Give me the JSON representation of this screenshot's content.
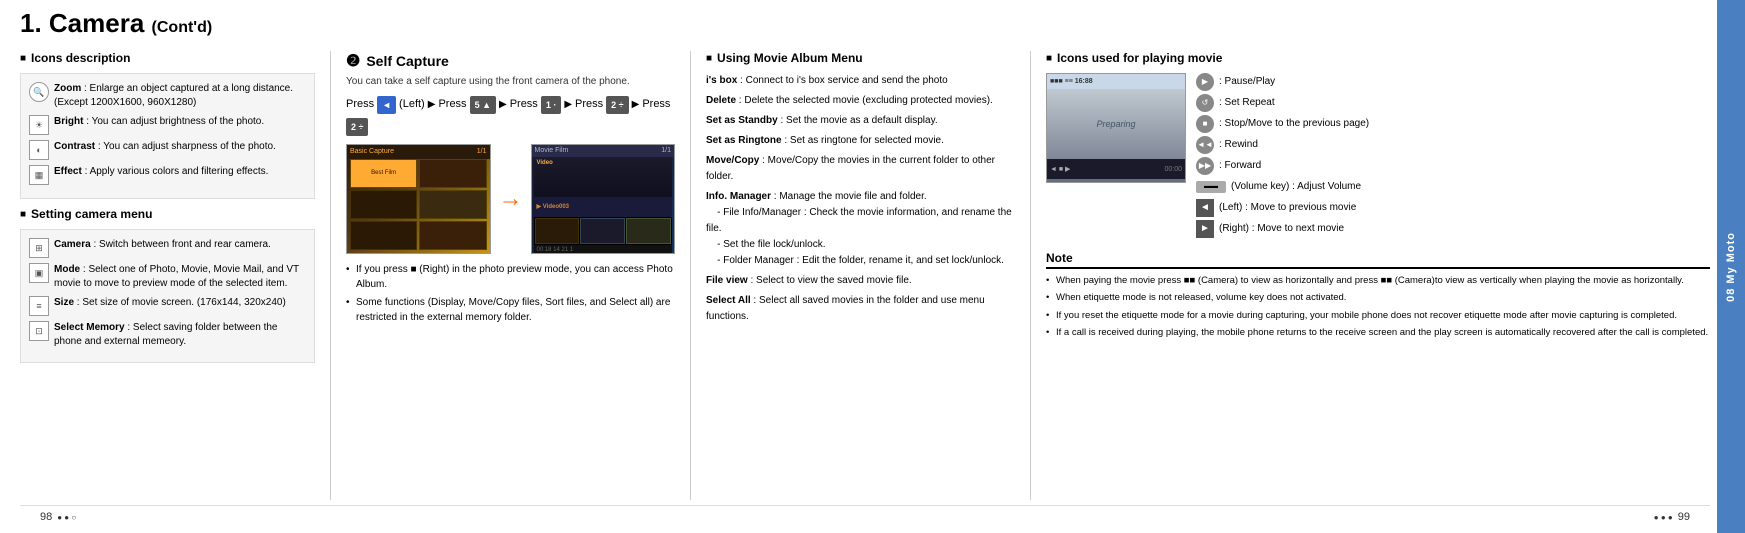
{
  "page": {
    "title": "1. Camera",
    "title_cont": "(Cont'd)",
    "chapter": "08 My Moto",
    "page_left": "98",
    "page_right": "99",
    "dots_left": "● ● ○",
    "dots_right": "● ● ● 99"
  },
  "col1": {
    "icons_title": "Icons description",
    "icons": [
      {
        "name": "Zoom",
        "desc": "Enlarge an object captured at a long distance. (Except 1200X1600, 960X1280)"
      },
      {
        "name": "Bright",
        "desc": "You can adjust brightness of the photo."
      },
      {
        "name": "Contrast",
        "desc": "You can adjust sharpness of the photo."
      },
      {
        "name": "Effect",
        "desc": "Apply various colors and filtering effects."
      }
    ],
    "settings_title": "Setting camera menu",
    "settings": [
      {
        "name": "Camera",
        "desc": "Switch between front and rear camera."
      },
      {
        "name": "Mode",
        "desc": "Select one of Photo, Movie, Movie Mail, and VT movie to move to preview mode of the selected item."
      },
      {
        "name": "Size",
        "desc": "Set size of movie screen. (176x144, 320x240)"
      },
      {
        "name": "Select Memory",
        "desc": "Select saving folder between the phone and external memeory."
      }
    ]
  },
  "col2": {
    "number": "❷",
    "title": "Self Capture",
    "subtitle": "You can take a self capture using the front camera of the phone.",
    "press_steps": [
      {
        "label": "Press",
        "btn": "◄ (Left)"
      },
      {
        "label": "Press",
        "btn": "5 ▲"
      },
      {
        "label": "Press",
        "btn": "1 ·"
      },
      {
        "label": "Press",
        "btn": "2 ÷"
      },
      {
        "label": "Press",
        "btn": "2 ÷"
      }
    ],
    "press_line_text": "Press ◄ (Left) ▶ Press 5 ▲ ▶ Press 1 · ▶ Press 2 ÷ ▶ Press 2 ÷",
    "note1": "If you press ■ (Right) in the photo preview mode, you can access Photo Album.",
    "note2": "Some functions (Display, Move/Copy files, Sort files, and Select all) are restricted in the external memory folder."
  },
  "col3": {
    "title": "Using Movie Album Menu",
    "items": [
      {
        "name": "i's box",
        "desc": "Connect to i's box service and send the photo"
      },
      {
        "name": "Delete",
        "desc": "Delete the selected movie (excluding protected movies)."
      },
      {
        "name": "Set as Standby",
        "desc": "Set the movie as a default display."
      },
      {
        "name": "Set as Ringtone",
        "desc": "Set as ringtone for selected movie."
      },
      {
        "name": "Move/Copy",
        "desc": "Move/Copy the movies in the current folder to other folder."
      },
      {
        "name": "Info. Manager",
        "desc": "Manage the movie file and folder.\n- File Info/Manager : Check the movie information, and rename the file.\n- Set the file lock/unlock.\n- Folder Manager : Edit the folder, rename it, and set lock/unlock."
      },
      {
        "name": "File view",
        "desc": "Select to view the saved movie file."
      },
      {
        "name": "Select All",
        "desc": "Select all saved movies in the folder and use menu functions."
      }
    ]
  },
  "col4": {
    "title": "Icons used for playing movie",
    "icons": [
      {
        "btn_type": "circle",
        "label": ": Pause/Play"
      },
      {
        "btn_type": "circle",
        "label": ": Set Repeat"
      },
      {
        "btn_type": "circle",
        "label": ": Stop/Move to the previous page)"
      },
      {
        "btn_type": "circle",
        "label": ": Rewind"
      },
      {
        "btn_type": "circle",
        "label": ": Forward"
      },
      {
        "btn_type": "rect",
        "label": "(Volume key) : Adjust Volume"
      },
      {
        "btn_type": "arrow_left",
        "label": "(Left) : Move to previous movie"
      },
      {
        "btn_type": "arrow_right",
        "label": "(Right) : Move to next movie"
      }
    ],
    "note_title": "Note",
    "notes": [
      "When paying the movie press ■■ (Camera) to view as horizontally and press ■■ (Camera)to view as vertically when playing the movie as horizontally.",
      "When etiquette mode is not released, volume key does not activated.",
      "If you reset the etiquette mode for a movie during capturing, your mobile phone does not recover etiquette mode after movie capturing is completed.",
      "If a call is received during playing, the mobile phone returns to the receive screen and the play screen is automatically recovered after the call is completed."
    ],
    "movie_preview_text": "Preparing",
    "pause_play_label": "Pause Play"
  }
}
